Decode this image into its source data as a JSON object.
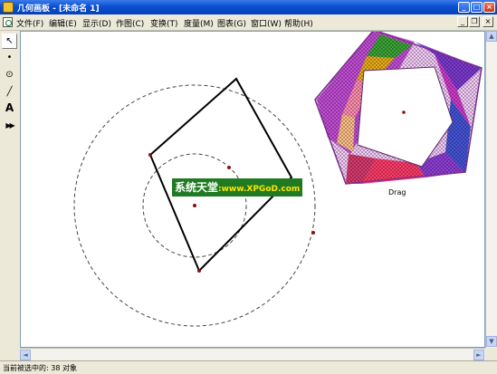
{
  "window": {
    "title": "几何画板 - [未命名 1]",
    "minimize_glyph": "_",
    "maximize_glyph": "□",
    "close_glyph": "×"
  },
  "menu": {
    "items": [
      "文件(F)",
      "编辑(E)",
      "显示(D)",
      "作图(C)",
      "变换(T)",
      "度量(M)",
      "图表(G)",
      "窗口(W)",
      "帮助(H)"
    ],
    "doc_minimize_glyph": "_",
    "doc_restore_glyph": "❐",
    "doc_close_glyph": "×"
  },
  "toolbox": {
    "tools": [
      {
        "name": "select-arrow-tool",
        "glyph": "↖",
        "active": true
      },
      {
        "name": "point-tool",
        "glyph": "•"
      },
      {
        "name": "compass-tool",
        "glyph": "⊙"
      },
      {
        "name": "straightedge-tool",
        "glyph": "╱"
      },
      {
        "name": "text-tool",
        "glyph": "A"
      },
      {
        "name": "custom-tool",
        "glyph": "▶▶"
      }
    ]
  },
  "canvas": {
    "drag_label": "Drag"
  },
  "watermark": {
    "cn": "系统天堂",
    "url": ":www.XPGoD.com"
  },
  "scrollbar": {
    "up": "▲",
    "down": "▼",
    "left": "◄",
    "right": "►"
  },
  "status": {
    "text": "当前被选中的: 38 对象"
  },
  "colors": {
    "titlebar": "#0a4fd2",
    "canvas_bg": "#ffffff",
    "quad_stroke": "#000000",
    "pentagon_outline": "#7a2e8c"
  }
}
